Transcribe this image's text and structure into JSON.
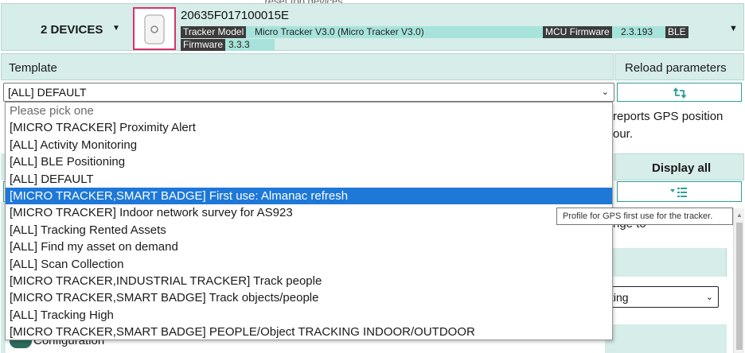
{
  "top_cut_text": "... reset top devices",
  "header": {
    "devices_label": "2 DEVICES",
    "serial": "20635F017100015E",
    "tracker_model_tag": "Tracker Model",
    "tracker_model_value": "Micro Tracker V3.0 (Micro Tracker V3.0)",
    "mcu_firmware_tag": "MCU Firmware",
    "mcu_firmware_value": "2.3.193",
    "ble_tag": "BLE",
    "firmware_tag": "Firmware",
    "ble_firmware_value": "3.3.3"
  },
  "template": {
    "label": "Template",
    "reload_label": "Reload parameters",
    "selected": "[ALL] DEFAULT",
    "description_fragment": [
      "reports GPS position",
      "our."
    ]
  },
  "display_all_label": "Display all",
  "ange_fragment": "nge to",
  "sub_select_fragment": "ting",
  "configuration_label": "Configuration",
  "dropdown": {
    "options": [
      "Please pick one",
      "[MICRO TRACKER] Proximity Alert",
      "[ALL] Activity Monitoring",
      "[ALL] BLE Positioning",
      "[ALL] DEFAULT",
      "[MICRO TRACKER,SMART BADGE] First use: Almanac refresh",
      "[MICRO TRACKER] Indoor network survey for AS923",
      "[ALL] Tracking Rented Assets",
      "[ALL] Find my asset on demand",
      "[ALL] Scan Collection",
      "[MICRO TRACKER,INDUSTRIAL TRACKER] Track people",
      "[MICRO TRACKER,SMART BADGE] Track objects/people",
      "[ALL] Tracking High",
      "[MICRO TRACKER,SMART BADGE] PEOPLE/Object TRACKING INDOOR/OUTDOOR"
    ],
    "highlighted_index": 5
  },
  "tooltip": "Profile for GPS first use for the tracker.",
  "colors": {
    "panel_bg": "#d6ede9",
    "strip_bg": "#a7e3da",
    "accent": "#2aa198",
    "selection": "#1e78d7",
    "thumb_border": "#d6336c"
  },
  "icons": {
    "devices_caret": "caret-down-icon",
    "header_caret": "caret-down-icon",
    "reload": "reload-icon",
    "display_all": "filter-list-icon"
  }
}
